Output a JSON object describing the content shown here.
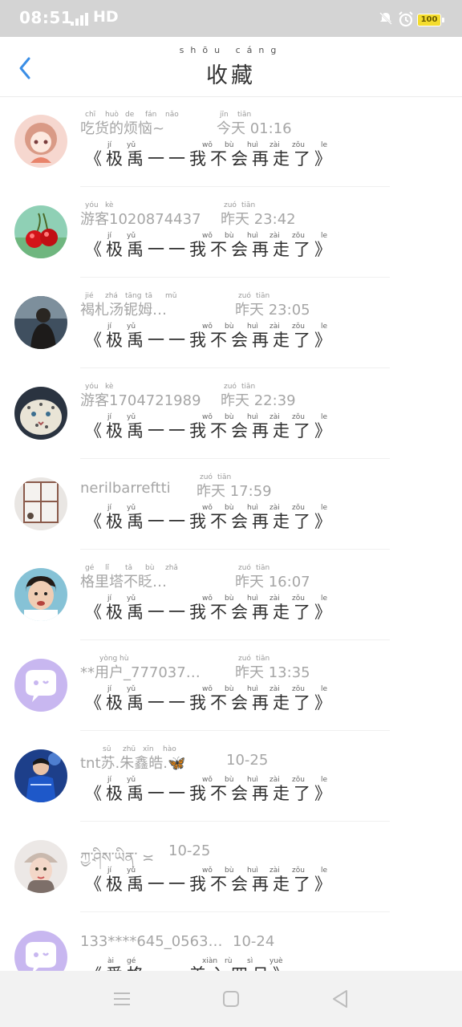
{
  "status_bar": {
    "time": "08:51",
    "network": "HD",
    "battery": "100",
    "icons": [
      "signal-icon",
      "mute-icon",
      "alarm-icon",
      "battery-icon"
    ]
  },
  "header": {
    "title": "收藏",
    "title_ruby": "shōu cáng",
    "back_icon": "chevron-left-icon",
    "accent_color": "#3a8ee6"
  },
  "items": [
    {
      "name": "吃货的烦恼~",
      "time": "今天 01:16",
      "name_ruby": [
        "chī",
        "huò",
        "de",
        "fán",
        "nǎo"
      ],
      "time_ruby": [
        "jīn",
        "tiān"
      ],
      "avatar": "anime-girl",
      "preview": "《极禹一一我不会再走了》",
      "preview_ruby": [
        "jí",
        "yǔ",
        "wǒ",
        "bù",
        "huì",
        "zài",
        "zǒu",
        "le"
      ]
    },
    {
      "name": "游客1020874437",
      "time": "昨天 23:42",
      "name_ruby": [
        "yóu",
        "kè"
      ],
      "time_ruby": [
        "zuó",
        "tiān"
      ],
      "avatar": "cherries",
      "preview": "《极禹一一我不会再走了》",
      "preview_ruby": [
        "jí",
        "yǔ",
        "wǒ",
        "bù",
        "huì",
        "zài",
        "zǒu",
        "le"
      ]
    },
    {
      "name": "褐札汤铌姆…",
      "time": "昨天 23:05",
      "name_ruby": [
        "jié",
        "zhá",
        "tāng",
        "tā",
        "mǔ"
      ],
      "time_ruby": [
        "zuó",
        "tiān"
      ],
      "avatar": "dark-person",
      "preview": "《极禹一一我不会再走了》",
      "preview_ruby": [
        "jí",
        "yǔ",
        "wǒ",
        "bù",
        "huì",
        "zài",
        "zǒu",
        "le"
      ]
    },
    {
      "name": "游客1704721989",
      "time": "昨天 22:39",
      "name_ruby": [
        "yóu",
        "kè"
      ],
      "time_ruby": [
        "zuó",
        "tiān"
      ],
      "avatar": "snow-leopard",
      "preview": "《极禹一一我不会再走了》",
      "preview_ruby": [
        "jí",
        "yǔ",
        "wǒ",
        "bù",
        "huì",
        "zài",
        "zǒu",
        "le"
      ]
    },
    {
      "name": "nerilbarreftti",
      "time": "昨天 17:59",
      "name_ruby": [],
      "time_ruby": [
        "zuó",
        "tiān"
      ],
      "avatar": "window-room",
      "preview": "《极禹一一我不会再走了》",
      "preview_ruby": [
        "jí",
        "yǔ",
        "wǒ",
        "bù",
        "huì",
        "zài",
        "zǒu",
        "le"
      ]
    },
    {
      "name": "格里塔不眨…",
      "time": "昨天 16:07",
      "name_ruby": [
        "gé",
        "lǐ",
        "tǎ",
        "bù",
        "zhǎ"
      ],
      "time_ruby": [
        "zuó",
        "tiān"
      ],
      "avatar": "boy-portrait",
      "preview": "《极禹一一我不会再走了》",
      "preview_ruby": [
        "jí",
        "yǔ",
        "wǒ",
        "bù",
        "huì",
        "zài",
        "zǒu",
        "le"
      ]
    },
    {
      "name": "**用户_777037…",
      "time": "昨天 13:35",
      "name_ruby": [
        "yòng",
        "hù"
      ],
      "time_ruby": [
        "zuó",
        "tiān"
      ],
      "avatar": "default-chat",
      "preview": "《极禹一一我不会再走了》",
      "preview_ruby": [
        "jí",
        "yǔ",
        "wǒ",
        "bù",
        "huì",
        "zài",
        "zǒu",
        "le"
      ]
    },
    {
      "name": "tnt苏.朱鑫皓.🦋",
      "time": "10-25",
      "name_ruby": [
        "sū",
        "zhū",
        "xīn",
        "hào"
      ],
      "time_ruby": [],
      "avatar": "performer-blue",
      "preview": "《极禹一一我不会再走了》",
      "preview_ruby": [
        "jí",
        "yǔ",
        "wǒ",
        "bù",
        "huì",
        "zài",
        "zǒu",
        "le"
      ]
    },
    {
      "name": "ཀྱ་ཤིས་ཡིན་ ≍",
      "time": "10-25",
      "name_ruby": [],
      "time_ruby": [],
      "avatar": "girl-hat",
      "preview": "《极禹一一我不会再走了》",
      "preview_ruby": [
        "jí",
        "yǔ",
        "wǒ",
        "bù",
        "huì",
        "zài",
        "zǒu",
        "le"
      ]
    },
    {
      "name": "133****645_0563…",
      "time": "10-24",
      "name_ruby": [],
      "time_ruby": [],
      "avatar": "default-chat",
      "preview": "《爱格一一美入四月》",
      "preview_ruby": [
        "ài",
        "gé",
        "xiàn",
        "rù",
        "sì",
        "yuè"
      ]
    }
  ],
  "nav": {
    "buttons": [
      "menu-icon",
      "home-icon",
      "back-triangle-icon"
    ]
  }
}
